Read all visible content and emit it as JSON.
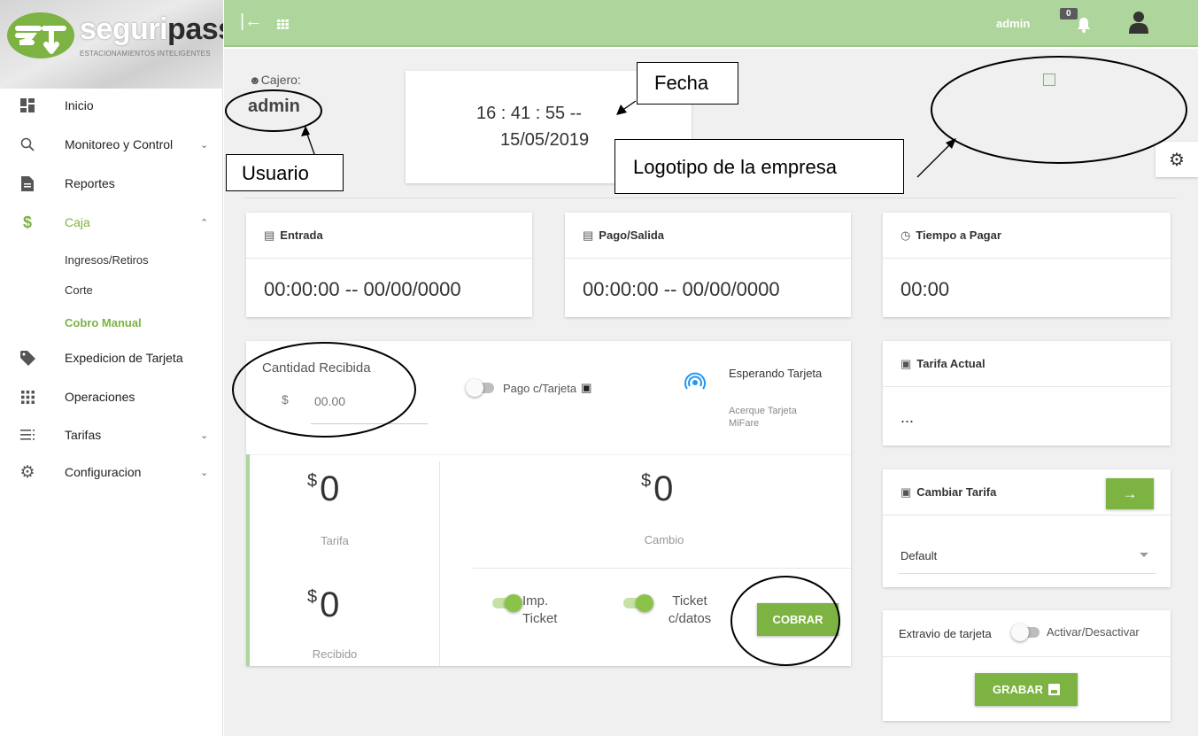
{
  "brand": {
    "name_part1": "seguri",
    "name_part2": "pass",
    "tagline": "ESTACIONAMIENTOS INTELIGENTES"
  },
  "sidebar": {
    "items": [
      {
        "label": "Inicio",
        "icon": "dashboard-icon"
      },
      {
        "label": "Monitoreo y Control",
        "icon": "search-icon"
      },
      {
        "label": "Reportes",
        "icon": "file-icon"
      },
      {
        "label": "Caja",
        "icon": "dollar-icon"
      },
      {
        "label": "Expedicion de Tarjeta",
        "icon": "tag-icon"
      },
      {
        "label": "Operaciones",
        "icon": "grid-icon"
      },
      {
        "label": "Tarifas",
        "icon": "list-icon"
      },
      {
        "label": "Configuracion",
        "icon": "gear-icon"
      }
    ],
    "caja_sub": [
      "Ingresos/Retiros",
      "Corte",
      "Cobro Manual"
    ]
  },
  "topbar": {
    "user": "admin",
    "notif_count": "0"
  },
  "cajero": {
    "label": "Cajero:",
    "name": "admin"
  },
  "clock": {
    "time": "16 : 41 : 55 --",
    "date": "15/05/2019"
  },
  "cards": {
    "entrada": {
      "title": "Entrada",
      "value": "00:00:00 -- 00/00/0000"
    },
    "pago_salida": {
      "title": "Pago/Salida",
      "value": "00:00:00 -- 00/00/0000"
    },
    "tiempo": {
      "title": "Tiempo a Pagar",
      "value": "00:00"
    },
    "tarifa_actual": {
      "title": "Tarifa Actual",
      "value": "..."
    },
    "cambiar_tarifa": {
      "title": "Cambiar Tarifa",
      "select_value": "Default"
    },
    "extravio": {
      "title": "Extravio de tarjeta",
      "toggle_label": "Activar/Desactivar",
      "button": "GRABAR"
    }
  },
  "payment": {
    "cantidad_label": "Cantidad Recibida",
    "currency": "$",
    "cantidad_placeholder": "00.00",
    "pago_tarjeta": "Pago c/Tarjeta",
    "esperando": "Esperando Tarjeta",
    "acerque": "Acerque Tarjeta MiFare",
    "tarifa_value": "0",
    "tarifa_label": "Tarifa",
    "recibido_value": "0",
    "recibido_label": "Recibido",
    "cambio_value": "0",
    "cambio_label": "Cambio",
    "imp_ticket": "Imp. Ticket",
    "ticket_datos": "Ticket c/datos",
    "cobrar": "COBRAR"
  },
  "annotations": {
    "fecha": "Fecha",
    "usuario": "Usuario",
    "logotipo": "Logotipo de la empresa"
  },
  "colors": {
    "accent": "#7cb342",
    "topbar": "#aed59c"
  }
}
